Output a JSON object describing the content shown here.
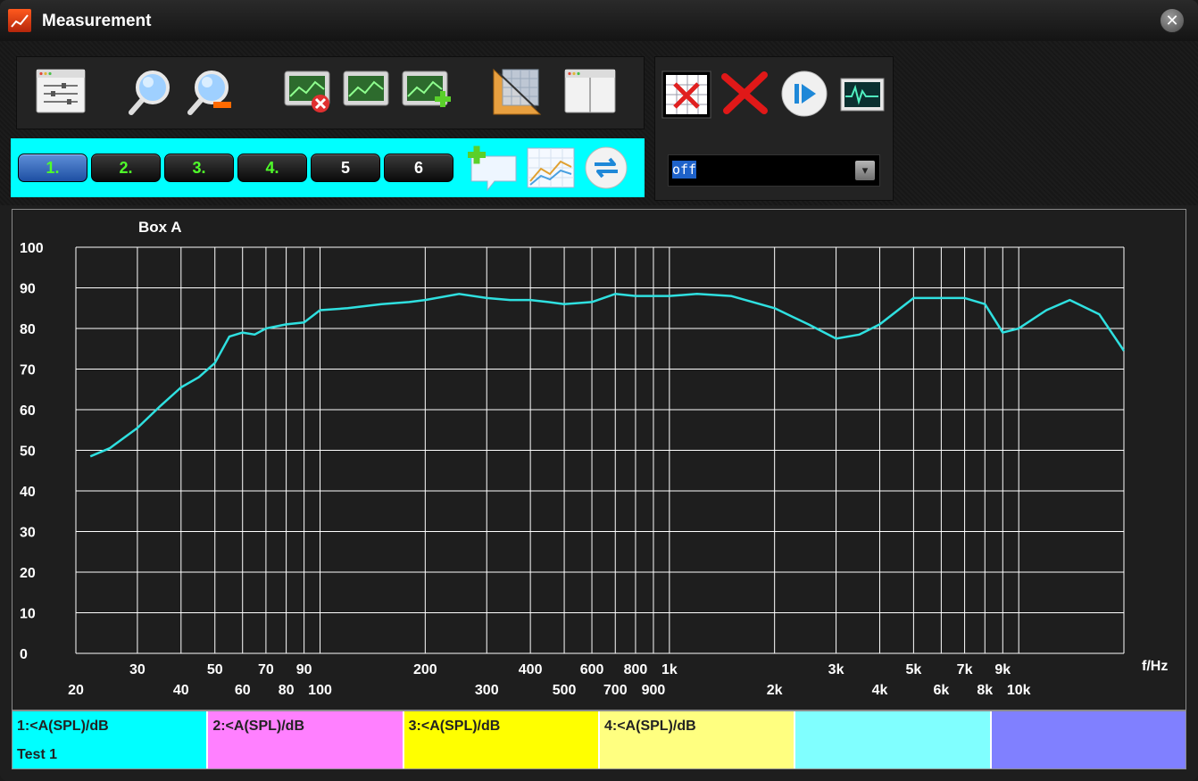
{
  "window": {
    "title": "Measurement"
  },
  "toolbar": {
    "icons": [
      "settings-window-icon",
      "zoom-in-icon",
      "zoom-out-icon",
      "delete-graph-icon",
      "graph-icon",
      "add-graph-icon",
      "ruler-icon",
      "split-window-icon"
    ]
  },
  "curve_tabs": [
    {
      "label": "1.",
      "state": "active",
      "text_color": "#4fff2a"
    },
    {
      "label": "2.",
      "state": "normal",
      "text_color": "#4fff2a"
    },
    {
      "label": "3.",
      "state": "normal",
      "text_color": "#4fff2a"
    },
    {
      "label": "4.",
      "state": "normal",
      "text_color": "#4fff2a"
    },
    {
      "label": "5",
      "state": "normal",
      "text_color": "#ffffff"
    },
    {
      "label": "6",
      "state": "normal",
      "text_color": "#ffffff"
    }
  ],
  "tab_extras": [
    "add-comment-icon",
    "chart-icon",
    "sync-icon"
  ],
  "right_toolbar": {
    "icons": [
      "clear-table-icon",
      "delete-icon",
      "play-icon",
      "oscilloscope-icon"
    ],
    "mode": {
      "value": "off"
    }
  },
  "colors": {
    "curve": "#2fe0e0",
    "accent_panel": "#00ffff",
    "grid": "#ffffff",
    "plot_background": "#1e1e1e"
  },
  "chart_data": {
    "type": "line",
    "title": "Box A",
    "xlabel": "f/Hz",
    "ylabel": "",
    "x_scale": "log",
    "xlim": [
      20,
      20000
    ],
    "ylim": [
      0,
      100
    ],
    "y_ticks": [
      0,
      10,
      20,
      30,
      40,
      50,
      60,
      70,
      80,
      90,
      100
    ],
    "x_ticks_upper": [
      {
        "value": 30,
        "label": "30"
      },
      {
        "value": 50,
        "label": "50"
      },
      {
        "value": 70,
        "label": "70"
      },
      {
        "value": 90,
        "label": "90"
      },
      {
        "value": 200,
        "label": "200"
      },
      {
        "value": 400,
        "label": "400"
      },
      {
        "value": 600,
        "label": "600"
      },
      {
        "value": 800,
        "label": "800"
      },
      {
        "value": 1000,
        "label": "1k"
      },
      {
        "value": 3000,
        "label": "3k"
      },
      {
        "value": 5000,
        "label": "5k"
      },
      {
        "value": 7000,
        "label": "7k"
      },
      {
        "value": 9000,
        "label": "9k"
      }
    ],
    "x_ticks_lower": [
      {
        "value": 20,
        "label": "20"
      },
      {
        "value": 40,
        "label": "40"
      },
      {
        "value": 60,
        "label": "60"
      },
      {
        "value": 80,
        "label": "80"
      },
      {
        "value": 100,
        "label": "100"
      },
      {
        "value": 300,
        "label": "300"
      },
      {
        "value": 500,
        "label": "500"
      },
      {
        "value": 700,
        "label": "700"
      },
      {
        "value": 900,
        "label": "900"
      },
      {
        "value": 2000,
        "label": "2k"
      },
      {
        "value": 4000,
        "label": "4k"
      },
      {
        "value": 6000,
        "label": "6k"
      },
      {
        "value": 8000,
        "label": "8k"
      },
      {
        "value": 10000,
        "label": "10k"
      }
    ],
    "grid_x": [
      20,
      30,
      40,
      50,
      60,
      70,
      80,
      90,
      100,
      200,
      300,
      400,
      500,
      600,
      700,
      800,
      900,
      1000,
      2000,
      3000,
      4000,
      5000,
      6000,
      7000,
      8000,
      9000,
      10000,
      20000
    ],
    "grid": true,
    "series": [
      {
        "x": [
          22,
          25,
          30,
          35,
          40,
          45,
          50,
          55,
          60,
          65,
          70,
          80,
          90,
          100,
          120,
          150,
          180,
          200,
          250,
          300,
          350,
          400,
          450,
          500,
          600,
          700,
          800,
          1000,
          1200,
          1500,
          2000,
          2500,
          3000,
          3500,
          4000,
          5000,
          6000,
          7000,
          8000,
          9000,
          10000,
          12000,
          14000,
          17000,
          20000
        ],
        "y": [
          48.5,
          50.5,
          55.5,
          61,
          65.5,
          68,
          71.5,
          78,
          79,
          78.5,
          80,
          81,
          81.5,
          84.5,
          85,
          86,
          86.5,
          87,
          88.5,
          87.5,
          87,
          87,
          86.5,
          86,
          86.5,
          88.5,
          88,
          88,
          88.5,
          88,
          85,
          81,
          77.5,
          78.5,
          81,
          87.5,
          87.5,
          87.5,
          86,
          79,
          80,
          84.5,
          87,
          83.5,
          74.5
        ]
      }
    ]
  },
  "legend": [
    {
      "label": "1:<A(SPL)/dB",
      "name": "Test 1",
      "color": "#00ffff"
    },
    {
      "label": "2:<A(SPL)/dB",
      "name": "",
      "color": "#ff80ff"
    },
    {
      "label": "3:<A(SPL)/dB",
      "name": "",
      "color": "#ffff00"
    },
    {
      "label": "4:<A(SPL)/dB",
      "name": "",
      "color": "#ffff80"
    },
    {
      "label": "",
      "name": "",
      "color": "#80ffff"
    },
    {
      "label": "",
      "name": "",
      "color": "#8080ff"
    }
  ]
}
